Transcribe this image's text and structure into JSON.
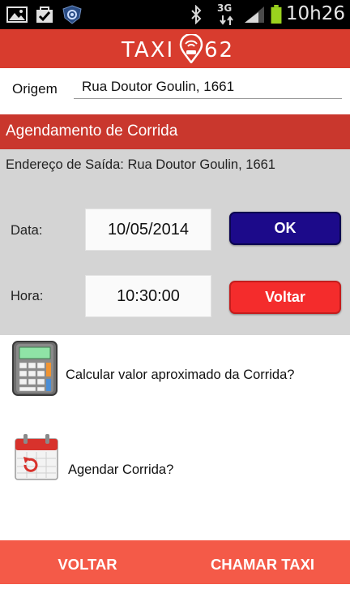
{
  "status_bar": {
    "time": "10h26",
    "network_label": "3G",
    "icons": [
      "gallery-icon",
      "download-complete-icon",
      "app-shield-icon",
      "bluetooth-icon",
      "network-3g-icon",
      "signal-icon",
      "battery-icon"
    ]
  },
  "header": {
    "logo_left": "TAXI",
    "logo_right": "62",
    "bg_color": "#d83c2e"
  },
  "origem": {
    "label": "Origem",
    "value": "Rua Doutor Goulin, 1661"
  },
  "scheduling": {
    "title": "Agendamento de Corrida",
    "address_line": "Endereço de Saída: Rua Doutor Goulin, 1661",
    "date_label": "Data:",
    "date_value": "10/05/2014",
    "time_label": "Hora:",
    "time_value": "10:30:00",
    "ok_button": "OK",
    "back_button": "Voltar"
  },
  "options": [
    {
      "label": "Calcular valor aproximado da Corrida?",
      "icon": "calculator-icon"
    },
    {
      "label": "Agendar Corrida?",
      "icon": "calendar-icon"
    }
  ],
  "bottom_bar": {
    "back_label": "VOLTAR",
    "call_label": "CHAMAR TAXI",
    "bg_color": "#f45a48"
  },
  "colors": {
    "ok_button": "#1c0a8a",
    "voltar_button": "#f42c2c",
    "section_title": "#c9372d",
    "panel": "#d4d4d4"
  }
}
